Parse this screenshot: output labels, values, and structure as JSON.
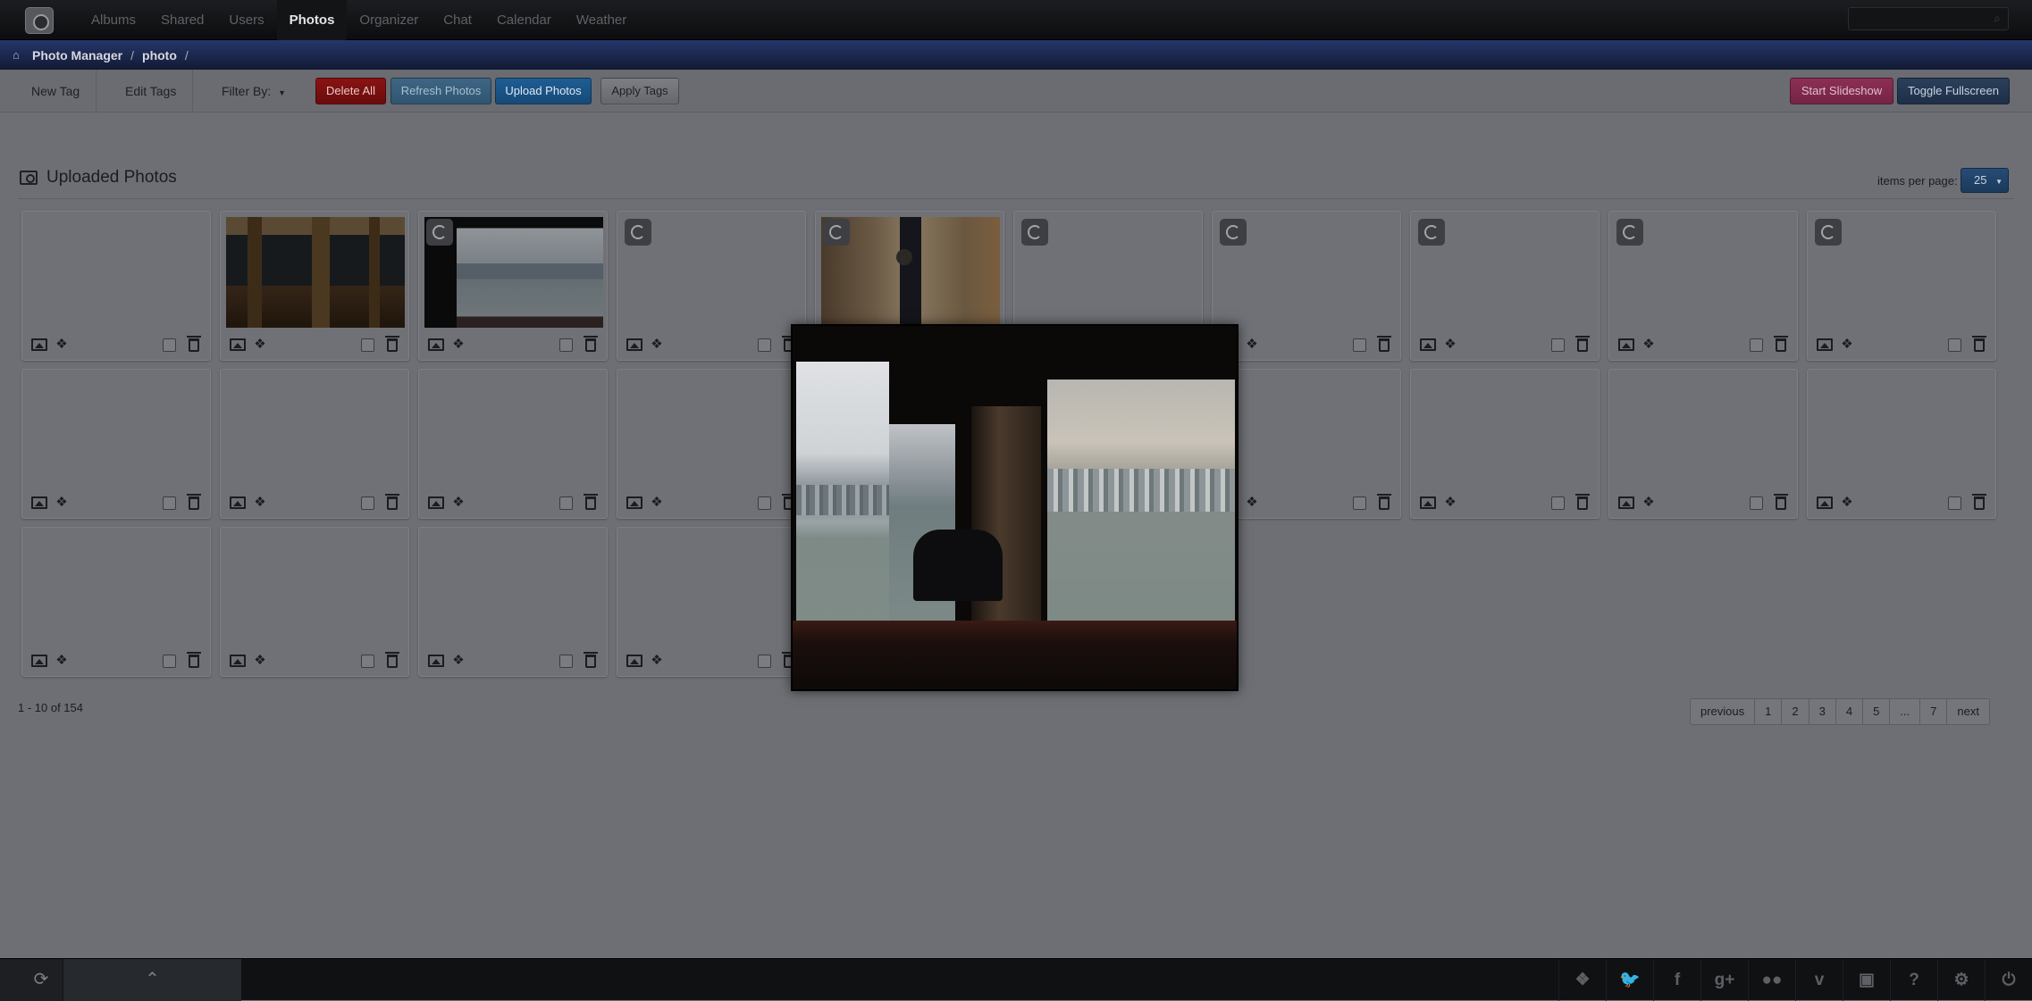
{
  "topnav": {
    "items": [
      {
        "label": "Albums"
      },
      {
        "label": "Shared"
      },
      {
        "label": "Users"
      },
      {
        "label": "Photos",
        "active": true
      },
      {
        "label": "Organizer"
      },
      {
        "label": "Chat"
      },
      {
        "label": "Calendar"
      },
      {
        "label": "Weather"
      }
    ],
    "search_icon": "search-icon"
  },
  "breadcrumb": {
    "home": "Photo Manager",
    "current": "photo",
    "sep": "/"
  },
  "toolbar": {
    "new_tag": "New Tag",
    "edit_tags": "Edit Tags",
    "filter_by": "Filter By:",
    "delete_all": "Delete All",
    "refresh_photos": "Refresh Photos",
    "upload_photos": "Upload Photos",
    "apply_tags": "Apply Tags",
    "start_slideshow": "Start Slideshow",
    "toggle_fullscreen": "Toggle Fullscreen"
  },
  "section": {
    "title": "Uploaded Photos",
    "items_per_page_label": "items per page:",
    "items_per_page": "25"
  },
  "cards": [
    {
      "state": "empty"
    },
    {
      "state": "hall"
    },
    {
      "state": "harbor"
    },
    {
      "state": "loading"
    },
    {
      "state": "market"
    },
    {
      "state": "loading"
    },
    {
      "state": "loading"
    },
    {
      "state": "loading"
    },
    {
      "state": "loading"
    },
    {
      "state": "loading"
    },
    {
      "state": "empty"
    },
    {
      "state": "empty"
    },
    {
      "state": "empty"
    },
    {
      "state": "empty"
    },
    {
      "state": "empty"
    },
    {
      "state": "empty"
    },
    {
      "state": "empty"
    },
    {
      "state": "empty"
    },
    {
      "state": "empty"
    },
    {
      "state": "empty"
    },
    {
      "state": "empty"
    },
    {
      "state": "empty"
    },
    {
      "state": "empty"
    },
    {
      "state": "empty"
    }
  ],
  "pagination": {
    "range": "1 - 10 of 154",
    "previous": "previous",
    "pages": [
      "1",
      "2",
      "3",
      "4",
      "5",
      "...",
      "7"
    ],
    "next": "next"
  },
  "footer": {
    "icons": [
      "dropbox-icon",
      "twitter-icon",
      "facebook-icon",
      "google-plus-icon",
      "flickr-icon",
      "vimeo-icon",
      "youtube-icon",
      "help-icon",
      "settings-icon",
      "logout-icon"
    ],
    "glyphs": [
      "❖",
      "🐦",
      "f",
      "g+",
      "●●",
      "v",
      "▣",
      "?",
      "⚙",
      "⏻"
    ]
  },
  "colors": {
    "accent_blue": "#1e5d93",
    "danger_red": "#8a1313",
    "slideshow_pink": "#8c2f55",
    "crumb_bar": "#26366a"
  }
}
